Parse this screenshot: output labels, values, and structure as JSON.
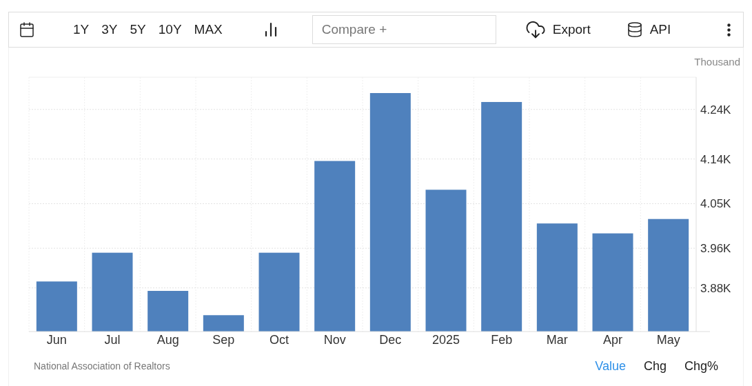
{
  "toolbar": {
    "ranges": [
      "1Y",
      "3Y",
      "5Y",
      "10Y",
      "MAX"
    ],
    "compare": {
      "placeholder": "Compare +"
    },
    "export": "Export",
    "api": "API"
  },
  "chart": {
    "unit": "Thousand",
    "chart_data": {
      "type": "bar",
      "categories": [
        "Jun",
        "Jul",
        "Aug",
        "Sep",
        "Oct",
        "Nov",
        "Dec",
        "2025",
        "Feb",
        "Mar",
        "Apr",
        "May"
      ],
      "grid": true,
      "series": [
        {
          "color": "#4f81bd",
          "values": [
            3.893,
            3.951,
            3.874,
            3.825,
            3.951,
            4.136,
            4.273,
            4.078,
            4.255,
            4.01,
            3.99,
            4.019
          ]
        }
      ],
      "ylim": [
        3.792,
        4.305
      ],
      "yticks": [
        {
          "value": 3.88,
          "label": "3.88K"
        },
        {
          "value": 3.96,
          "label": "3.96K"
        },
        {
          "value": 4.05,
          "label": "4.05K"
        },
        {
          "value": 4.14,
          "label": "4.14K"
        },
        {
          "value": 4.24,
          "label": "4.24K"
        }
      ]
    }
  },
  "footer": {
    "source": "National Association of Realtors",
    "views": [
      {
        "label": "Value",
        "selected": true
      },
      {
        "label": "Chg",
        "selected": false
      },
      {
        "label": "Chg%",
        "selected": false
      }
    ]
  }
}
